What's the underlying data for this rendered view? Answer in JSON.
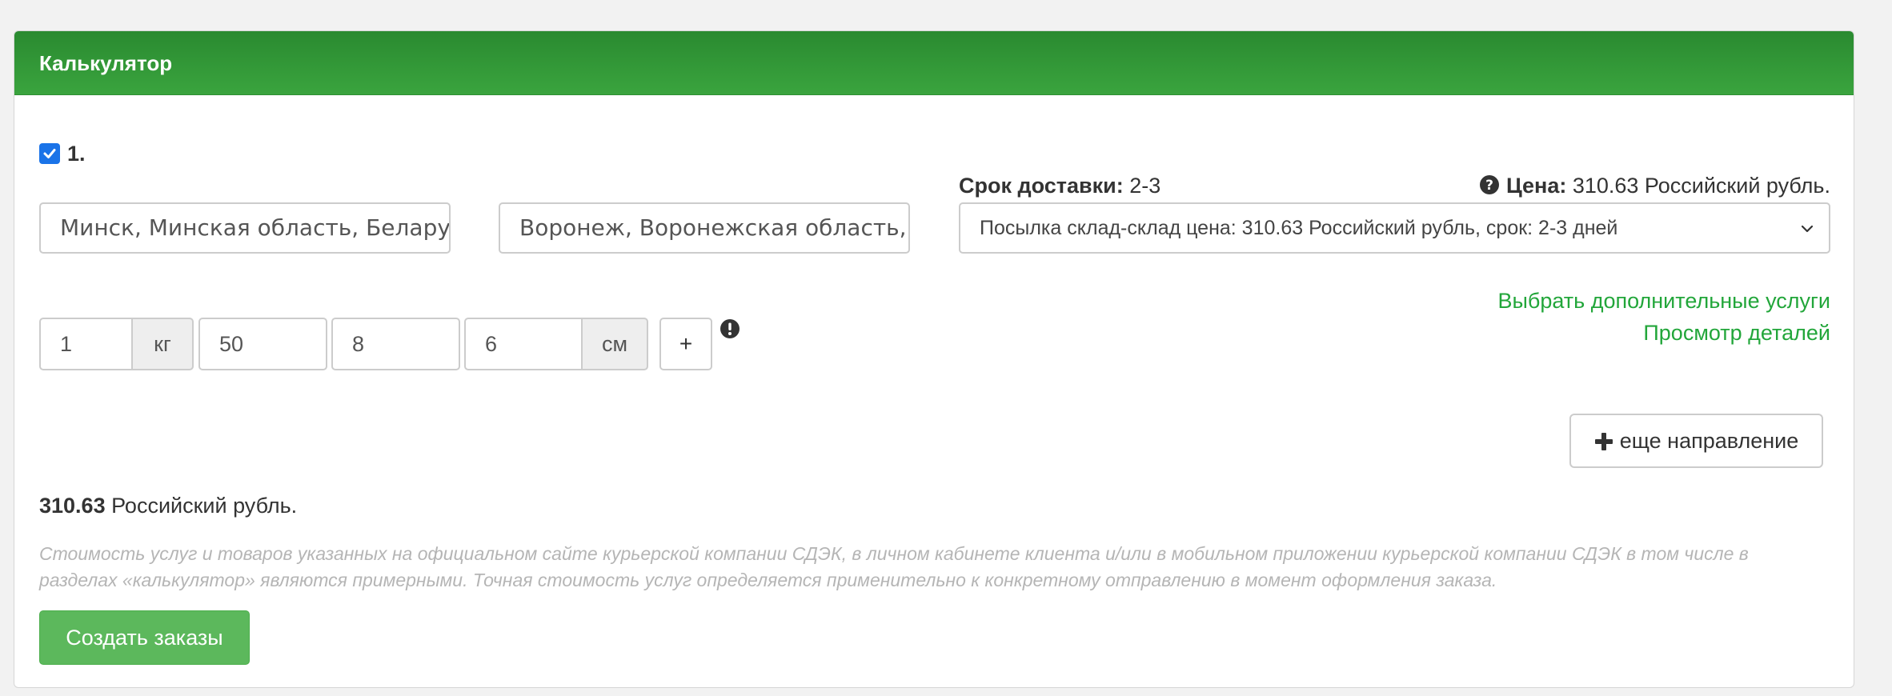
{
  "panel": {
    "title": "Калькулятор"
  },
  "route": {
    "index_label": "1.",
    "selected": true,
    "from_value": "Минск, Минская область, Беларусь",
    "to_value": "Воронеж, Воронежская область, Россия"
  },
  "delivery": {
    "term_label": "Срок доставки:",
    "term_value": "2-3",
    "price_label": "Цена:",
    "price_value": "310.63 Российский рубль.",
    "tariff_selected": "Посылка склад-склад цена: 310.63 Российский рубль, срок: 2-3 дней",
    "extra_services_link": "Выбрать дополнительные услуги",
    "details_link": "Просмотр деталей"
  },
  "package": {
    "weight_value": "1",
    "weight_unit": "кг",
    "length_value": "50",
    "width_value": "8",
    "height_value": "6",
    "size_unit": "см",
    "add_label": "+"
  },
  "actions": {
    "add_direction_label": "еще направление",
    "create_orders_label": "Создать заказы"
  },
  "summary": {
    "total_amount": "310.63",
    "total_currency": "Российский рубль.",
    "disclaimer": "Стоимость услуг и товаров указанных на официальном сайте курьерской компании СДЭК, в личном кабинете клиента и/или в мобильном приложении курьерской компании СДЭК в том числе в разделах «калькулятор» являются примерными. Точная стоимость услуг определяется применительно к конкретному отправлению в момент оформления заказа."
  },
  "colors": {
    "header_green": "#2a8a30",
    "link_green": "#22a63a",
    "button_green": "#5cb85c",
    "checkbox_blue": "#1a73e8"
  }
}
